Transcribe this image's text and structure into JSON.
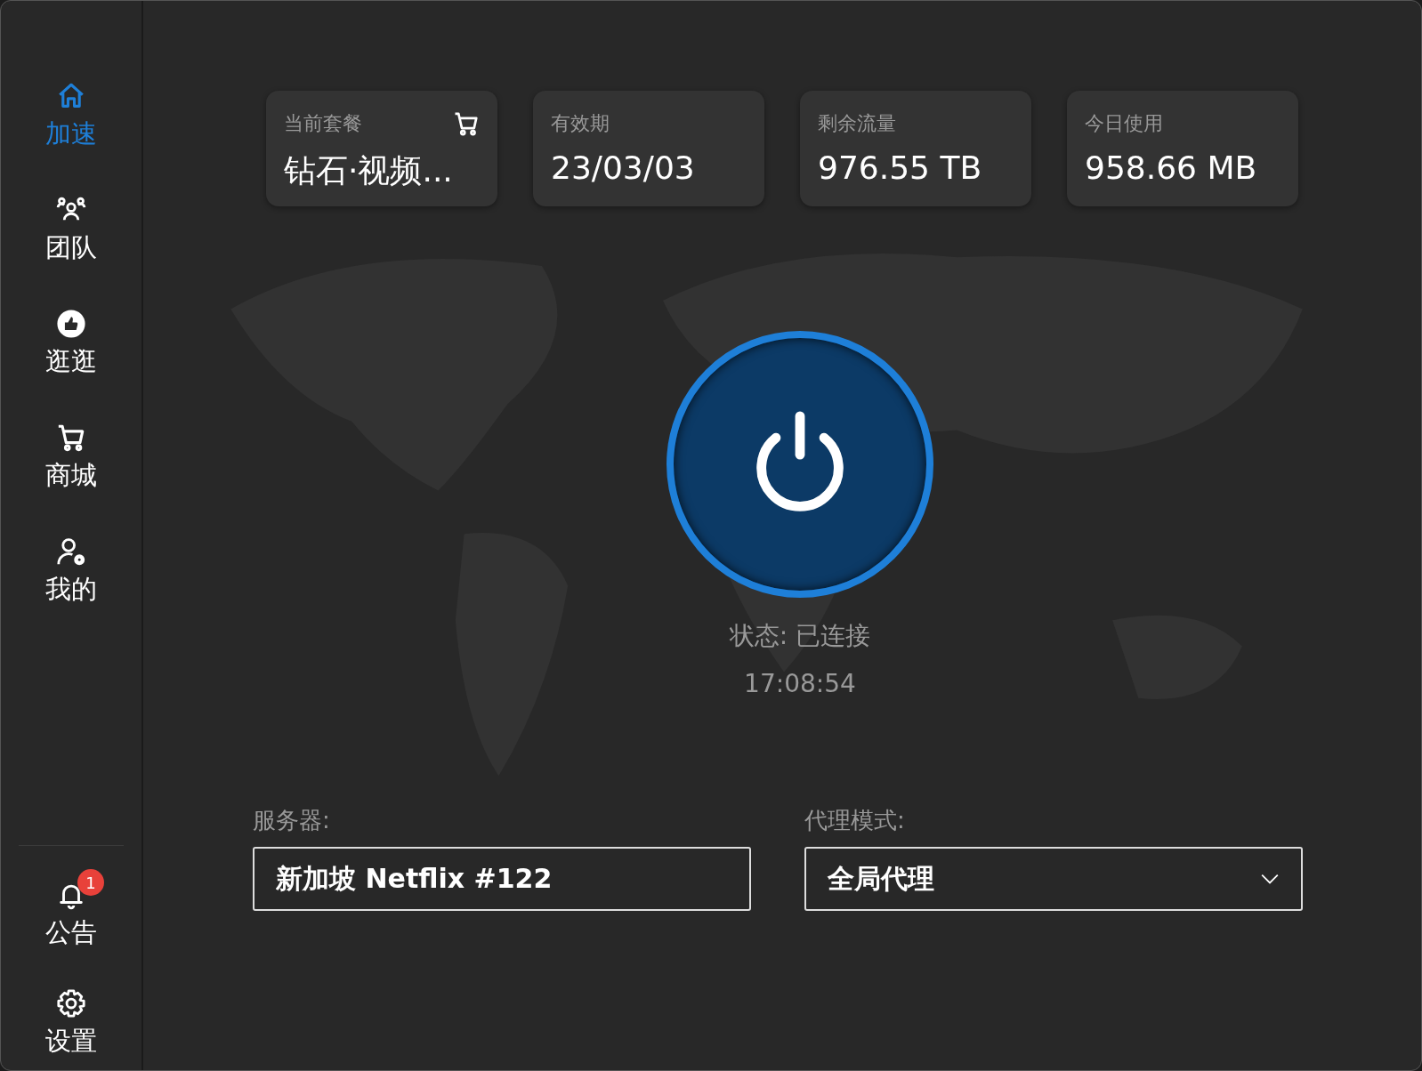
{
  "sidebar": {
    "items": [
      {
        "label": "加速",
        "selected": true
      },
      {
        "label": "团队",
        "selected": false
      },
      {
        "label": "逛逛",
        "selected": false
      },
      {
        "label": "商城",
        "selected": false
      },
      {
        "label": "我的",
        "selected": false
      }
    ],
    "bottom_items": [
      {
        "label": "公告",
        "badge": "1"
      },
      {
        "label": "设置"
      }
    ]
  },
  "stats": [
    {
      "label": "当前套餐",
      "value": "钻石·视频...",
      "cart": true
    },
    {
      "label": "有效期",
      "value": "23/03/03",
      "cart": false
    },
    {
      "label": "剩余流量",
      "value": "976.55 TB",
      "cart": false
    },
    {
      "label": "今日使用",
      "value": "958.66 MB",
      "cart": false
    }
  ],
  "power": {
    "connected": true,
    "status": "状态: 已连接",
    "time": "17:08:54"
  },
  "server": {
    "label": "服务器:",
    "value": "新加坡 Netflix #122"
  },
  "proxy_mode": {
    "label": "代理模式:",
    "value": "全局代理"
  }
}
